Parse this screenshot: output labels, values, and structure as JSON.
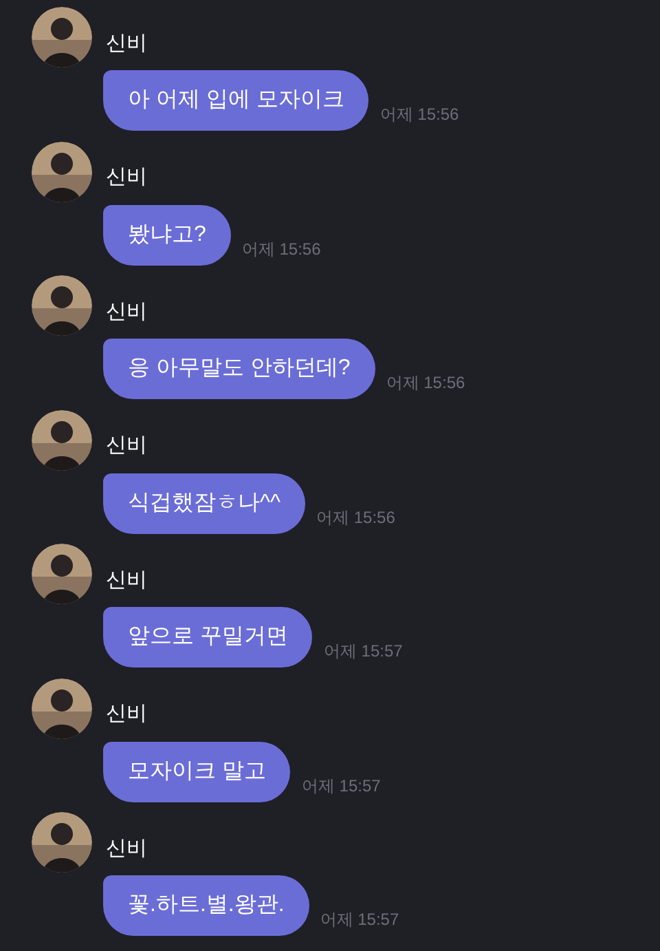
{
  "messages": [
    {
      "sender": "신비",
      "text": "아 어제 입에 모자이크",
      "time": "어제 15:56"
    },
    {
      "sender": "신비",
      "text": "봤냐고?",
      "time": "어제 15:56"
    },
    {
      "sender": "신비",
      "text": "응 아무말도 안하던데?",
      "time": "어제 15:56"
    },
    {
      "sender": "신비",
      "text": "식겁했잠ㅎ나^^",
      "time": "어제 15:56"
    },
    {
      "sender": "신비",
      "text": "앞으로 꾸밀거면",
      "time": "어제 15:57"
    },
    {
      "sender": "신비",
      "text": "모자이크 말고",
      "time": "어제 15:57"
    },
    {
      "sender": "신비",
      "text": "꽃.하트.별.왕관.",
      "time": "어제 15:57"
    }
  ]
}
